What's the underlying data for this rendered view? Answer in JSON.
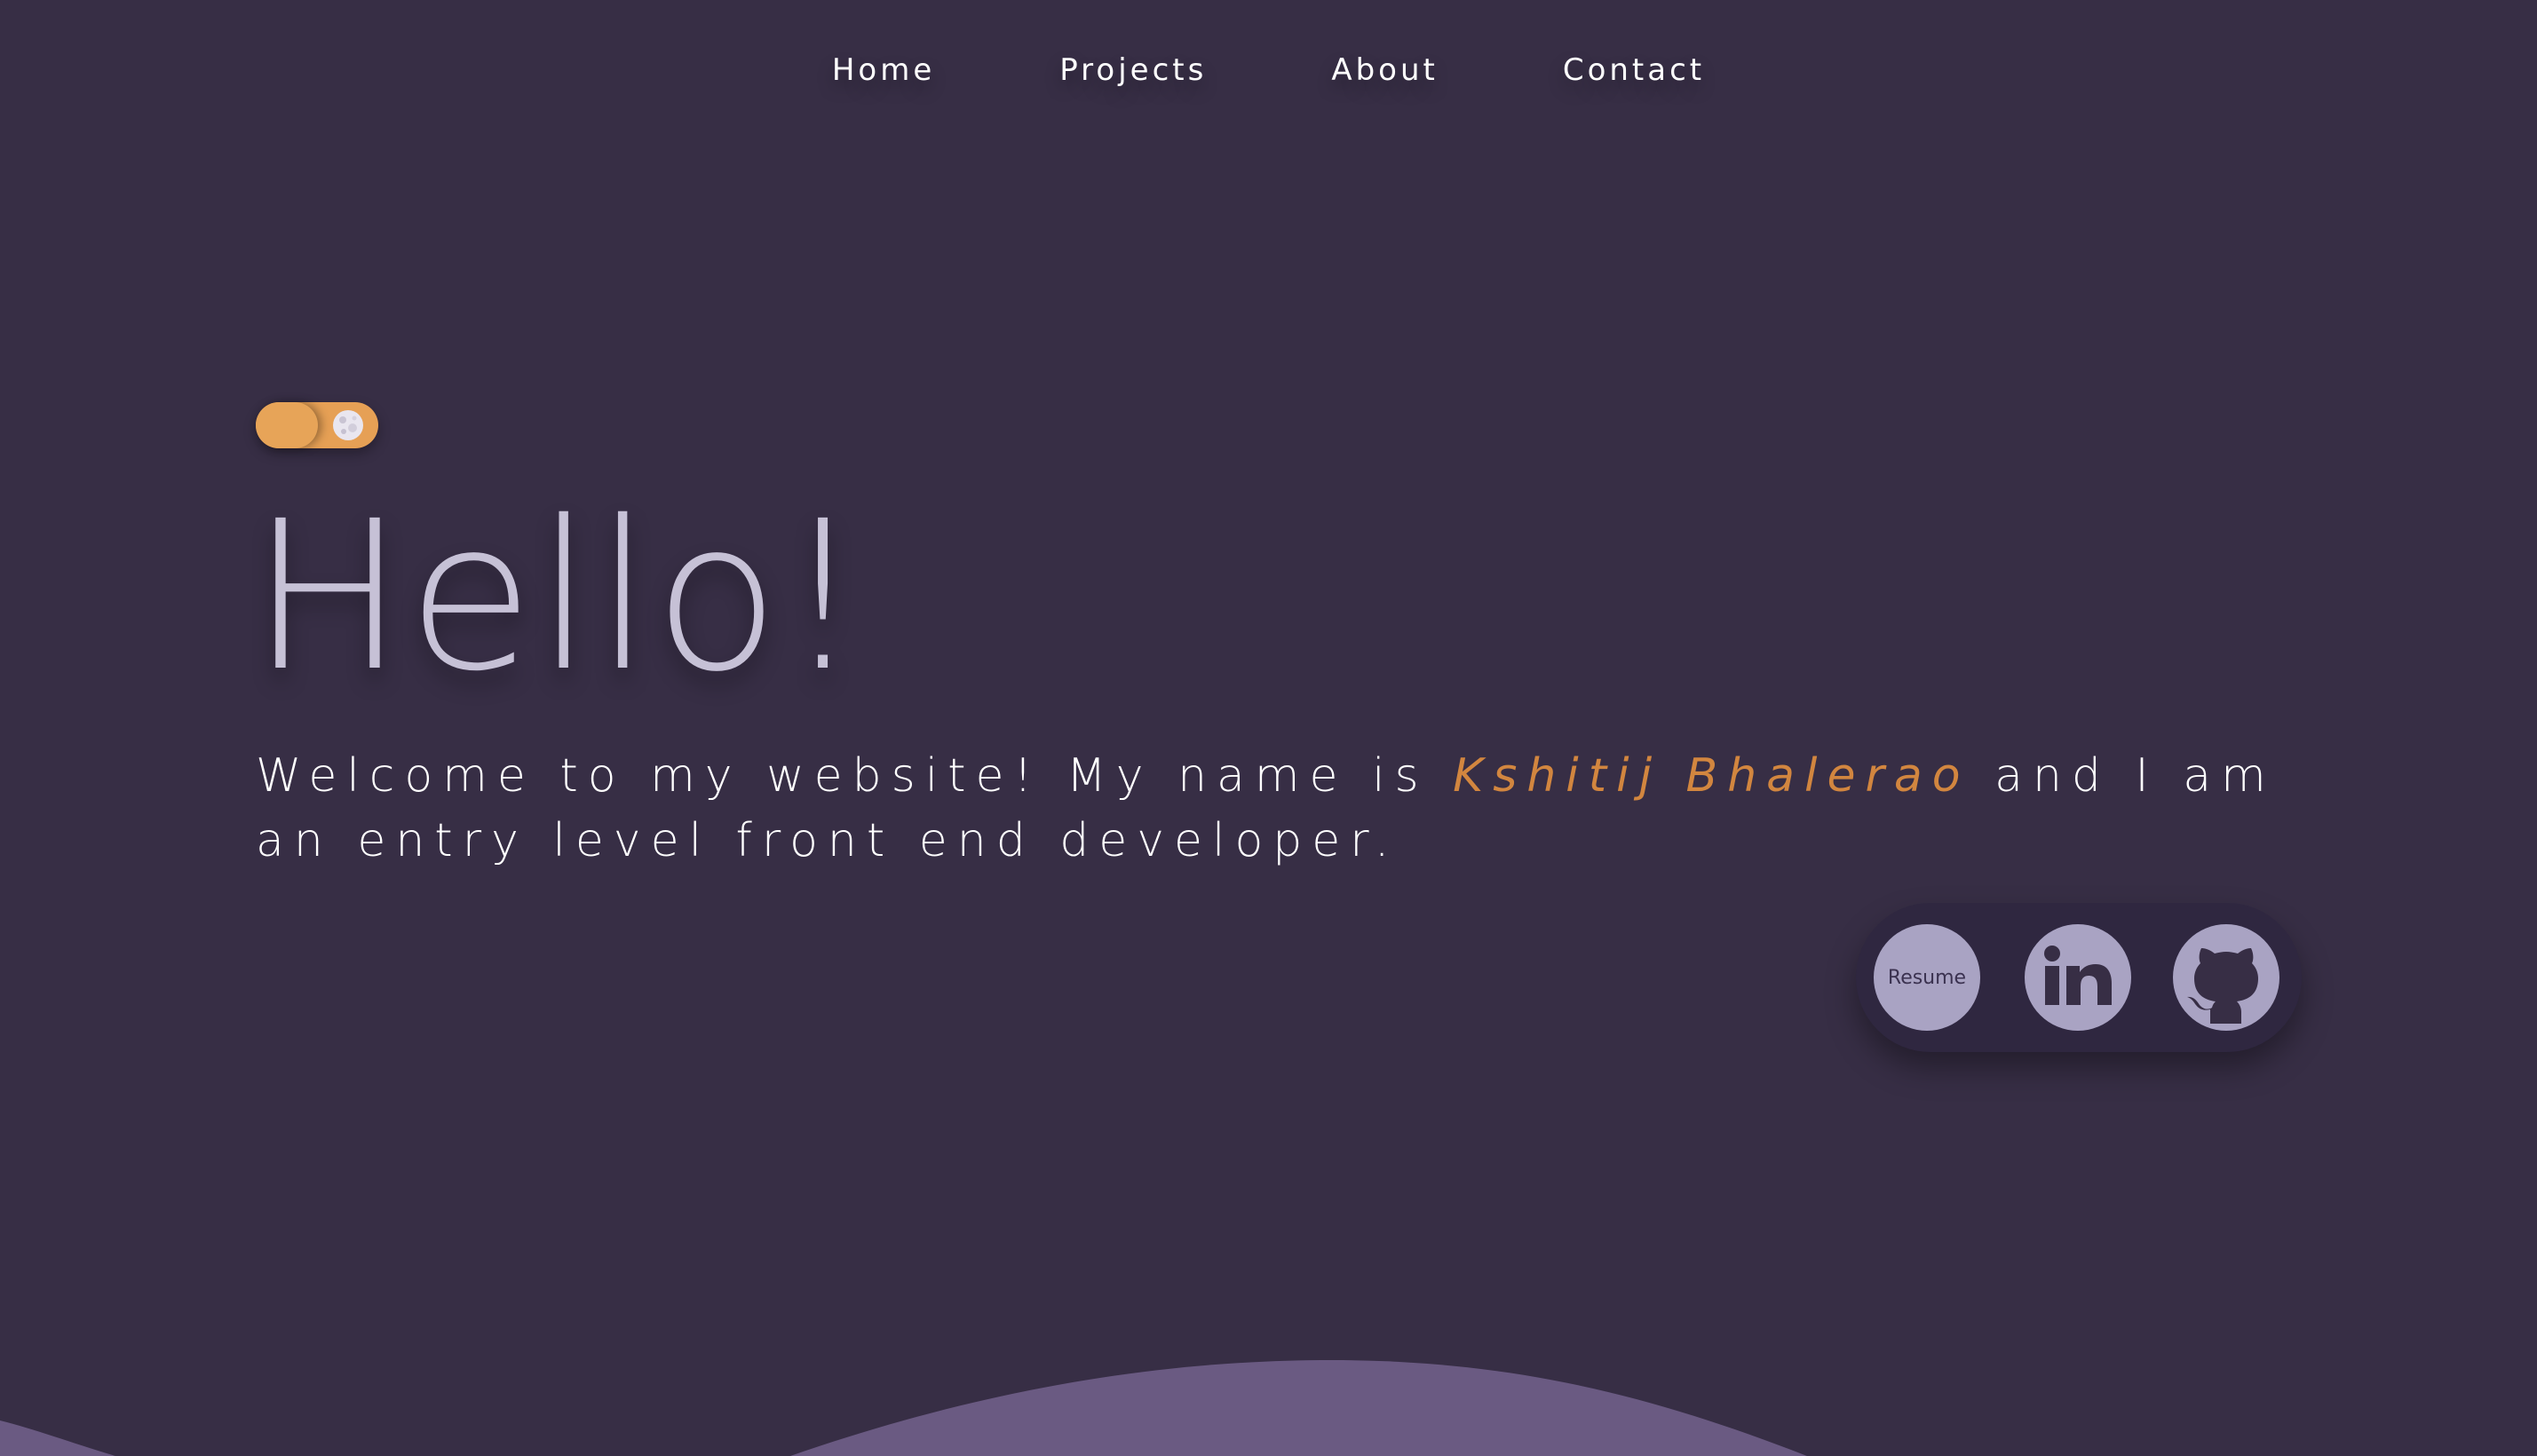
{
  "nav": {
    "items": [
      {
        "label": "Home"
      },
      {
        "label": "Projects"
      },
      {
        "label": "About"
      },
      {
        "label": "Contact"
      }
    ]
  },
  "theme_toggle": {
    "state": "dark",
    "moon_icon": "moon-icon"
  },
  "hero": {
    "title": "Hello!",
    "intro_before": "Welcome to my website! My name is ",
    "name": "Kshitij Bhalerao",
    "intro_after": " and I am an entry level front end developer."
  },
  "social": {
    "resume_label": "Resume",
    "linkedin_icon": "linkedin-icon",
    "github_icon": "github-icon"
  },
  "colors": {
    "background": "#372e45",
    "accent": "#e6a055",
    "name_text": "#d2863f",
    "title_text": "#c6c1d6",
    "social_button": "#a9a3c3",
    "wave": "#6a5a82"
  }
}
